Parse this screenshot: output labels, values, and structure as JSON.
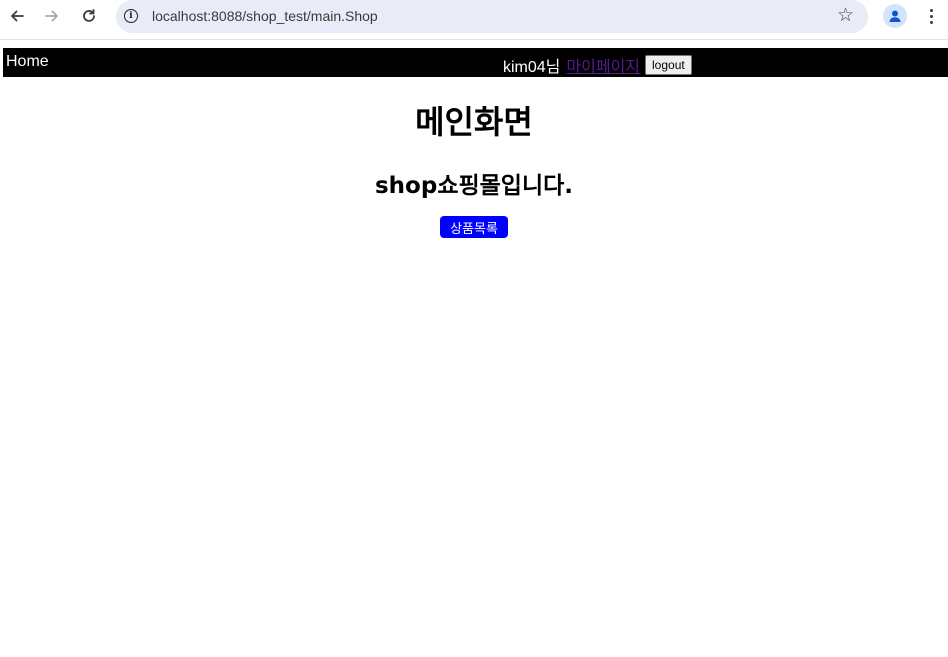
{
  "browser": {
    "url": "localhost:8088/shop_test/main.Shop",
    "icons": {
      "back": "arrow-left",
      "forward": "arrow-right",
      "reload": "reload",
      "info": "info-circle",
      "bookmark": "star-outline",
      "profile": "person",
      "menu": "vertical-dots"
    }
  },
  "header": {
    "home_label": "Home",
    "username": "kim04님",
    "mypage_label": "마이페이지",
    "logout_label": "logout"
  },
  "main": {
    "title": "메인화면",
    "subtitle": "shop쇼핑몰입니다.",
    "product_button_label": "상품목록"
  },
  "colors": {
    "header_bg": "#000000",
    "header_text": "#ffffff",
    "visited_link": "#551a8b",
    "button_bg": "#0000ff",
    "button_text": "#ffffff",
    "omnibox_bg": "#e9ecf6"
  }
}
